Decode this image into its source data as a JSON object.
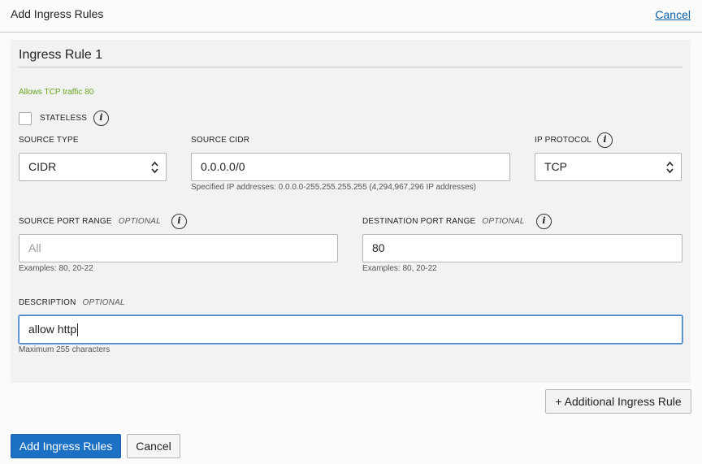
{
  "header": {
    "title": "Add Ingress Rules",
    "cancel_link": "Cancel"
  },
  "rule": {
    "title": "Ingress Rule 1",
    "summary": "Allows TCP traffic 80",
    "stateless": {
      "label": "STATELESS",
      "checked": false
    },
    "source_type": {
      "label": "SOURCE TYPE",
      "value": "CIDR"
    },
    "source_cidr": {
      "label": "SOURCE CIDR",
      "value": "0.0.0.0/0",
      "hint": "Specified IP addresses: 0.0.0.0-255.255.255.255 (4,294,967,296 IP addresses)"
    },
    "ip_protocol": {
      "label": "IP PROTOCOL",
      "value": "TCP"
    },
    "source_port_range": {
      "label": "SOURCE PORT RANGE",
      "optional": "OPTIONAL",
      "placeholder": "All",
      "hint": "Examples: 80, 20-22"
    },
    "destination_port_range": {
      "label": "DESTINATION PORT RANGE",
      "optional": "OPTIONAL",
      "value": "80",
      "hint": "Examples: 80, 20-22"
    },
    "description": {
      "label": "DESCRIPTION",
      "optional": "OPTIONAL",
      "value": "allow http",
      "hint": "Maximum 255 characters"
    }
  },
  "buttons": {
    "additional_rule": "+ Additional Ingress Rule",
    "submit": "Add Ingress Rules",
    "cancel": "Cancel"
  },
  "icons": {
    "info": "info-icon",
    "select_arrows": "chevron-up-down-icon"
  },
  "colors": {
    "primary": "#1d71c5",
    "link": "#0b5ea8",
    "summary_text": "#6aa521",
    "focus_border": "#4a86c8"
  }
}
